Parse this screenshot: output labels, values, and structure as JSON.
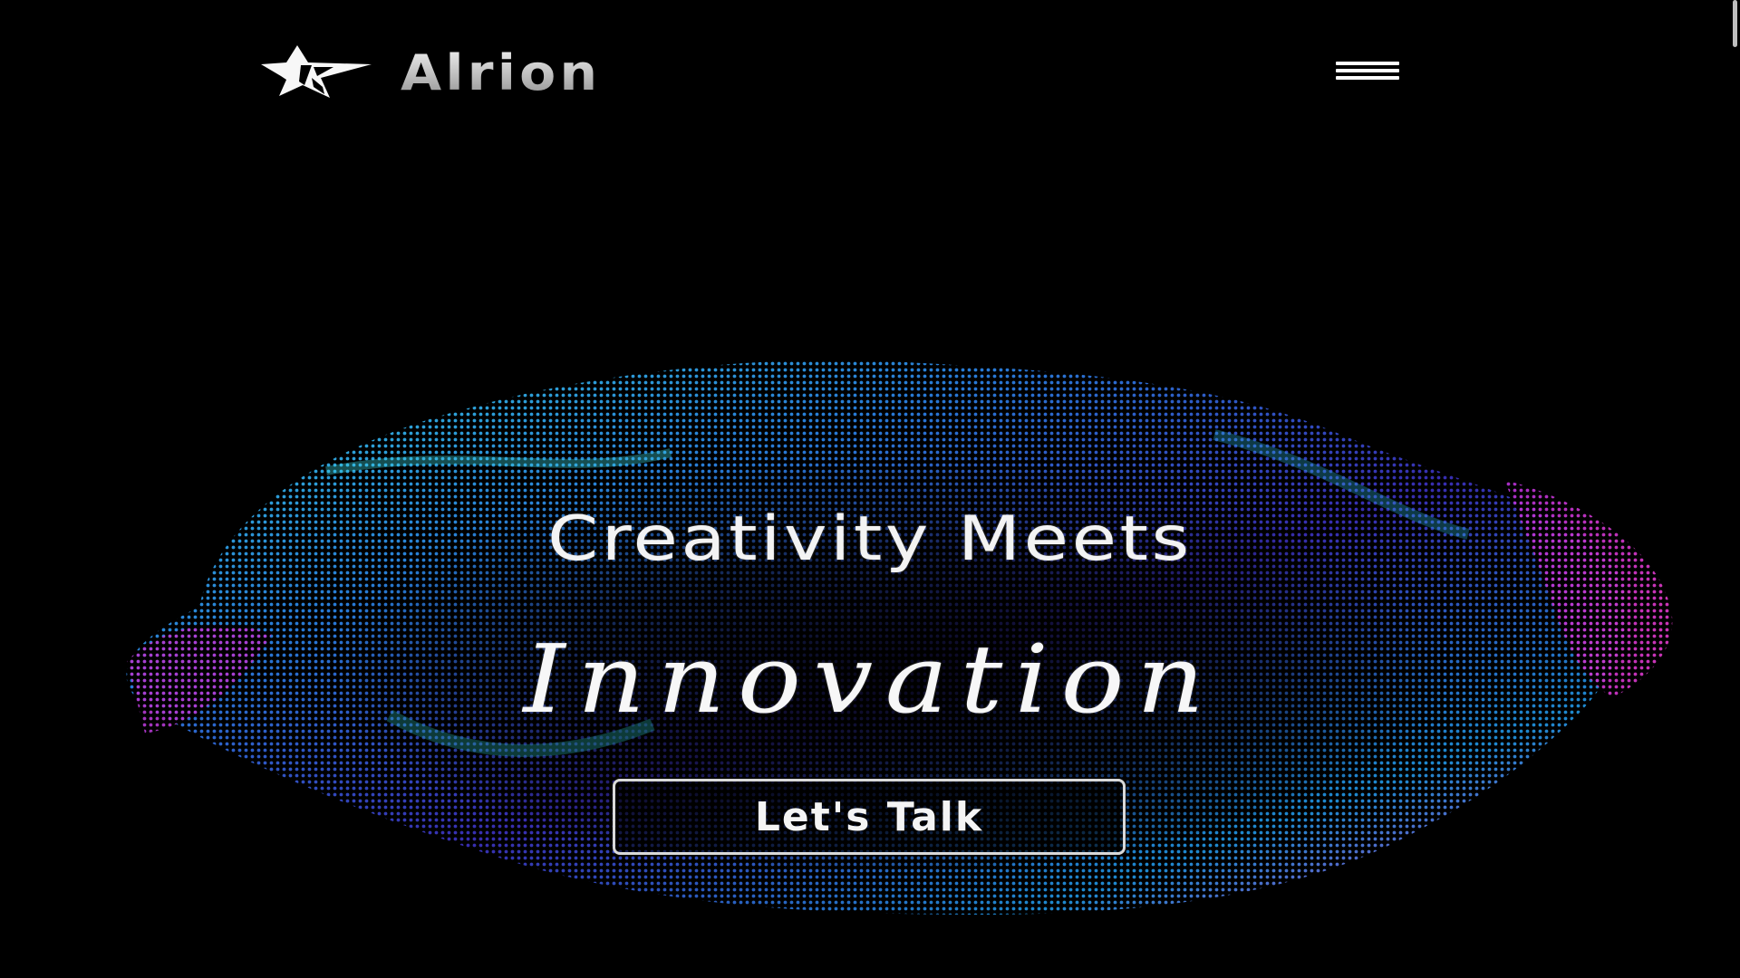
{
  "brand": {
    "name": "Alrion",
    "icon": "star-icon"
  },
  "header": {
    "menu_icon": "hamburger-menu-icon"
  },
  "hero": {
    "title_line1": "Creativity Meets",
    "title_line2": "Innovation",
    "cta_label": "Let's Talk",
    "background": "particle-wave-artwork"
  },
  "colors": {
    "background": "#000000",
    "text": "#f3f3f3",
    "accent_cyan": "#2fd0e0",
    "accent_blue": "#1e5bd8",
    "accent_magenta": "#c026d3",
    "accent_purple": "#6a2bd8"
  }
}
